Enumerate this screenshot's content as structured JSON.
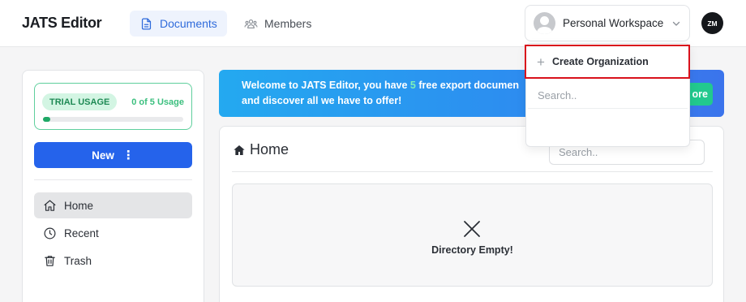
{
  "app": {
    "title": "JATS Editor"
  },
  "nav": {
    "tabs": [
      {
        "label": "Documents",
        "icon": "document-icon",
        "active": true
      },
      {
        "label": "Members",
        "icon": "users-icon",
        "active": false
      }
    ]
  },
  "workspace": {
    "label": "Personal Workspace"
  },
  "user": {
    "initials": "ZM"
  },
  "sidebar": {
    "trial": {
      "badge": "TRIAL USAGE",
      "usage": "0 of 5 Usage",
      "progress": 0.05
    },
    "new_button": {
      "label": "New",
      "menu": "⋮"
    },
    "items": [
      {
        "label": "Home",
        "icon": "home-icon",
        "active": true
      },
      {
        "label": "Recent",
        "icon": "clock-icon",
        "active": false
      },
      {
        "label": "Trash",
        "icon": "trash-icon",
        "active": false
      }
    ]
  },
  "banner": {
    "line1_prefix": "Welcome to JATS Editor, you have ",
    "line1_highlight": "5",
    "line1_suffix": " free export documen",
    "line2": "and discover all we have to offer!",
    "button": "ore"
  },
  "main": {
    "title": "Home",
    "search_placeholder": "Search..",
    "empty_text": "Directory Empty!"
  },
  "dropdown": {
    "create_label": "Create Organization",
    "search_placeholder": "Search.."
  },
  "colors": {
    "accent": "#2563eb",
    "highlight_border": "#d9121c",
    "trial_green": "#1fa866",
    "banner_start": "#24a9f0",
    "banner_end": "#3b74ec"
  }
}
